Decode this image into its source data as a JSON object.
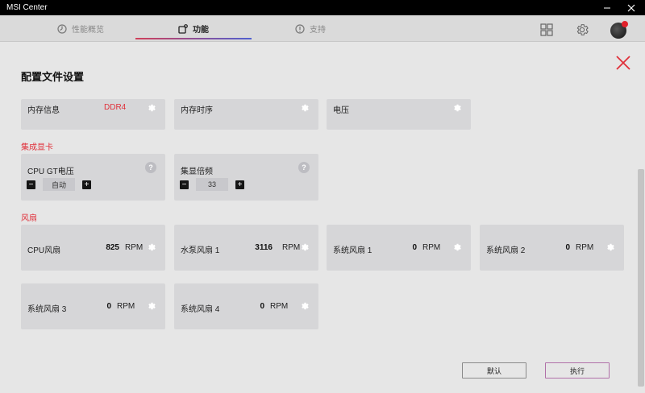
{
  "window": {
    "title": "MSI Center"
  },
  "nav": {
    "tabs": [
      {
        "label": "性能概览"
      },
      {
        "label": "功能"
      },
      {
        "label": "支持"
      }
    ]
  },
  "page": {
    "title": "配置文件设置"
  },
  "memory_cards": [
    {
      "label": "内存信息",
      "value": "DDR4"
    },
    {
      "label": "内存时序"
    },
    {
      "label": "电压"
    }
  ],
  "igpu": {
    "section_title": "集成显卡",
    "cards": [
      {
        "label": "CPU GT电压",
        "value": "自动"
      },
      {
        "label": "集显倍频",
        "value": "33"
      }
    ]
  },
  "fans": {
    "section_title": "风扇",
    "unit": "RPM",
    "cards": [
      {
        "label": "CPU风扇",
        "rpm": "825"
      },
      {
        "label": "水泵风扇 1",
        "rpm": "3116"
      },
      {
        "label": "系统风扇 1",
        "rpm": "0"
      },
      {
        "label": "系统风扇 2",
        "rpm": "0"
      },
      {
        "label": "系统风扇 3",
        "rpm": "0"
      },
      {
        "label": "系统风扇 4",
        "rpm": "0"
      }
    ]
  },
  "footer": {
    "default_label": "默认",
    "apply_label": "执行"
  },
  "colors": {
    "accent": "#e0303a",
    "titlebar": "#000000",
    "card": "#d6d6d8",
    "background": "#e6e6e6"
  },
  "icons": [
    "minimize-icon",
    "maximize-icon",
    "close-icon",
    "gauge-icon",
    "feature-icon",
    "help-circle-icon",
    "grid-icon",
    "gear-icon",
    "close-x-icon",
    "question-icon"
  ]
}
